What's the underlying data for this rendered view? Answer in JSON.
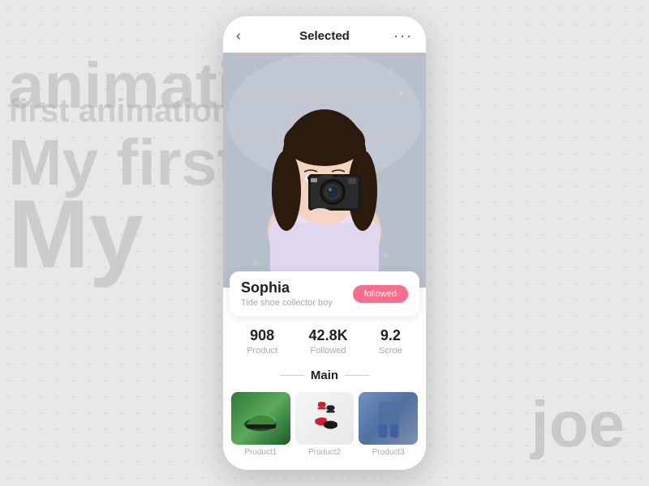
{
  "background": {
    "text1": "animation",
    "text2": "first animation",
    "text3": "My first",
    "text4": "My",
    "text5": "joe"
  },
  "header": {
    "back_icon": "‹",
    "title": "Selected",
    "more_icon": "···"
  },
  "profile": {
    "name": "Sophia",
    "subtitle": "Tide shoe collector boy",
    "followed_label": "followed"
  },
  "stats": [
    {
      "value": "908",
      "label": "Product"
    },
    {
      "value": "42.8K",
      "label": "Followed"
    },
    {
      "value": "9.2",
      "label": "Scroe"
    }
  ],
  "section": {
    "title": "Main"
  },
  "products": [
    {
      "label": "Product1"
    },
    {
      "label": "Product2"
    },
    {
      "label": "Product3"
    }
  ]
}
